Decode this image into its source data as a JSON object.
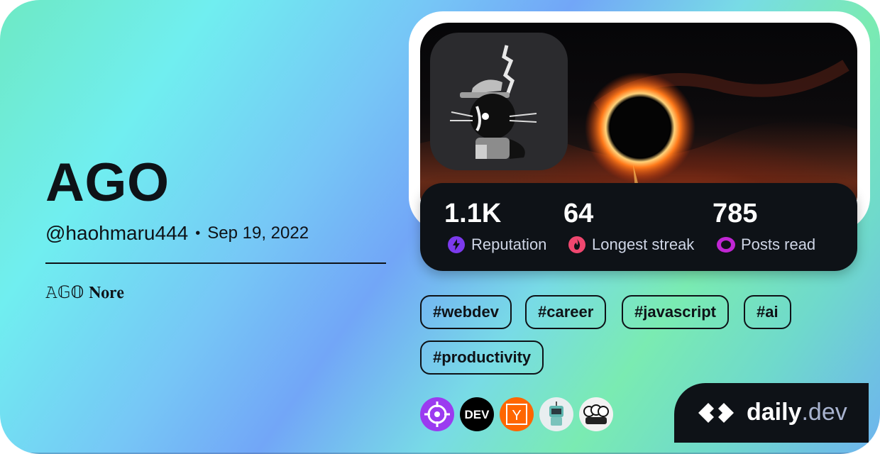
{
  "profile": {
    "name": "AGO",
    "handle": "@haohmaru444",
    "separator": "•",
    "joined": "Sep 19, 2022",
    "bio": "𝙰𝔾𝕆 𝐍𝐨𝐫𝐞"
  },
  "stats": [
    {
      "value": "1.1K",
      "label": "Reputation",
      "icon": "lightning-icon",
      "color": "#7c3aed"
    },
    {
      "value": "64",
      "label": "Longest streak",
      "icon": "flame-icon",
      "color": "#ef476f"
    },
    {
      "value": "785",
      "label": "Posts read",
      "icon": "eye-icon",
      "color": "#c026d3"
    }
  ],
  "tags": [
    "#webdev",
    "#career",
    "#javascript",
    "#ai",
    "#productivity"
  ],
  "sources": [
    {
      "name": "crosshair-source-icon",
      "color": "#9b3bf0",
      "text": ""
    },
    {
      "name": "dev-source-icon",
      "color": "#000000",
      "text": "DEV"
    },
    {
      "name": "hacker-news-source-icon",
      "color": "#ff6600",
      "text": "Y"
    },
    {
      "name": "robot-source-icon",
      "color": "#e8eef0",
      "text": ""
    },
    {
      "name": "mascots-source-icon",
      "color": "#f2f2f2",
      "text": ""
    }
  ],
  "brand": {
    "name": "daily",
    "suffix": ".dev"
  }
}
